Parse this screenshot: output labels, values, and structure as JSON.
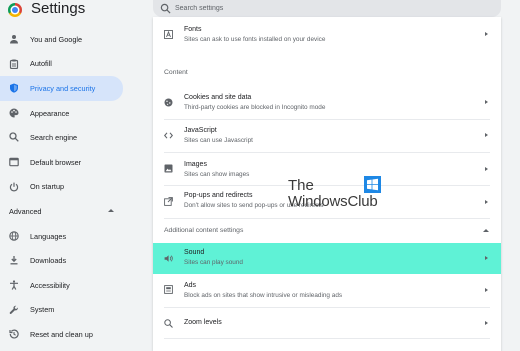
{
  "app": {
    "title": "Settings"
  },
  "search": {
    "placeholder": "Search settings"
  },
  "sidebar": {
    "items": [
      {
        "label": "You and Google",
        "icon": "person-icon"
      },
      {
        "label": "Autofill",
        "icon": "clipboard-icon"
      },
      {
        "label": "Privacy and security",
        "icon": "shield-icon",
        "active": true
      },
      {
        "label": "Appearance",
        "icon": "palette-icon"
      },
      {
        "label": "Search engine",
        "icon": "search-icon"
      },
      {
        "label": "Default browser",
        "icon": "browser-window-icon"
      },
      {
        "label": "On startup",
        "icon": "power-icon"
      }
    ],
    "advanced_label": "Advanced",
    "advanced_items": [
      {
        "label": "Languages",
        "icon": "globe-icon"
      },
      {
        "label": "Downloads",
        "icon": "download-icon"
      },
      {
        "label": "Accessibility",
        "icon": "accessibility-icon"
      },
      {
        "label": "System",
        "icon": "wrench-icon"
      },
      {
        "label": "Reset and clean up",
        "icon": "history-icon"
      }
    ]
  },
  "main": {
    "fonts": {
      "title": "Fonts",
      "subtitle": "Sites can ask to use fonts installed on your device"
    },
    "content_label": "Content",
    "cookies": {
      "title": "Cookies and site data",
      "subtitle": "Third-party cookies are blocked in Incognito mode"
    },
    "javascript": {
      "title": "JavaScript",
      "subtitle": "Sites can use Javascript"
    },
    "images": {
      "title": "Images",
      "subtitle": "Sites can show images"
    },
    "popups": {
      "title": "Pop-ups and redirects",
      "subtitle": "Don't allow sites to send pop-ups or use redirects"
    },
    "additional_label": "Additional content settings",
    "sound": {
      "title": "Sound",
      "subtitle": "Sites can play sound"
    },
    "ads": {
      "title": "Ads",
      "subtitle": "Block ads on sites that show intrusive or misleading ads"
    },
    "zoom": {
      "title": "Zoom levels"
    }
  },
  "watermark": {
    "line1": "The",
    "line2": "WindowsClub"
  },
  "colors": {
    "accent": "#1a73e8",
    "active_bg": "#d6e4fa",
    "highlight": "#5ff2d6"
  }
}
